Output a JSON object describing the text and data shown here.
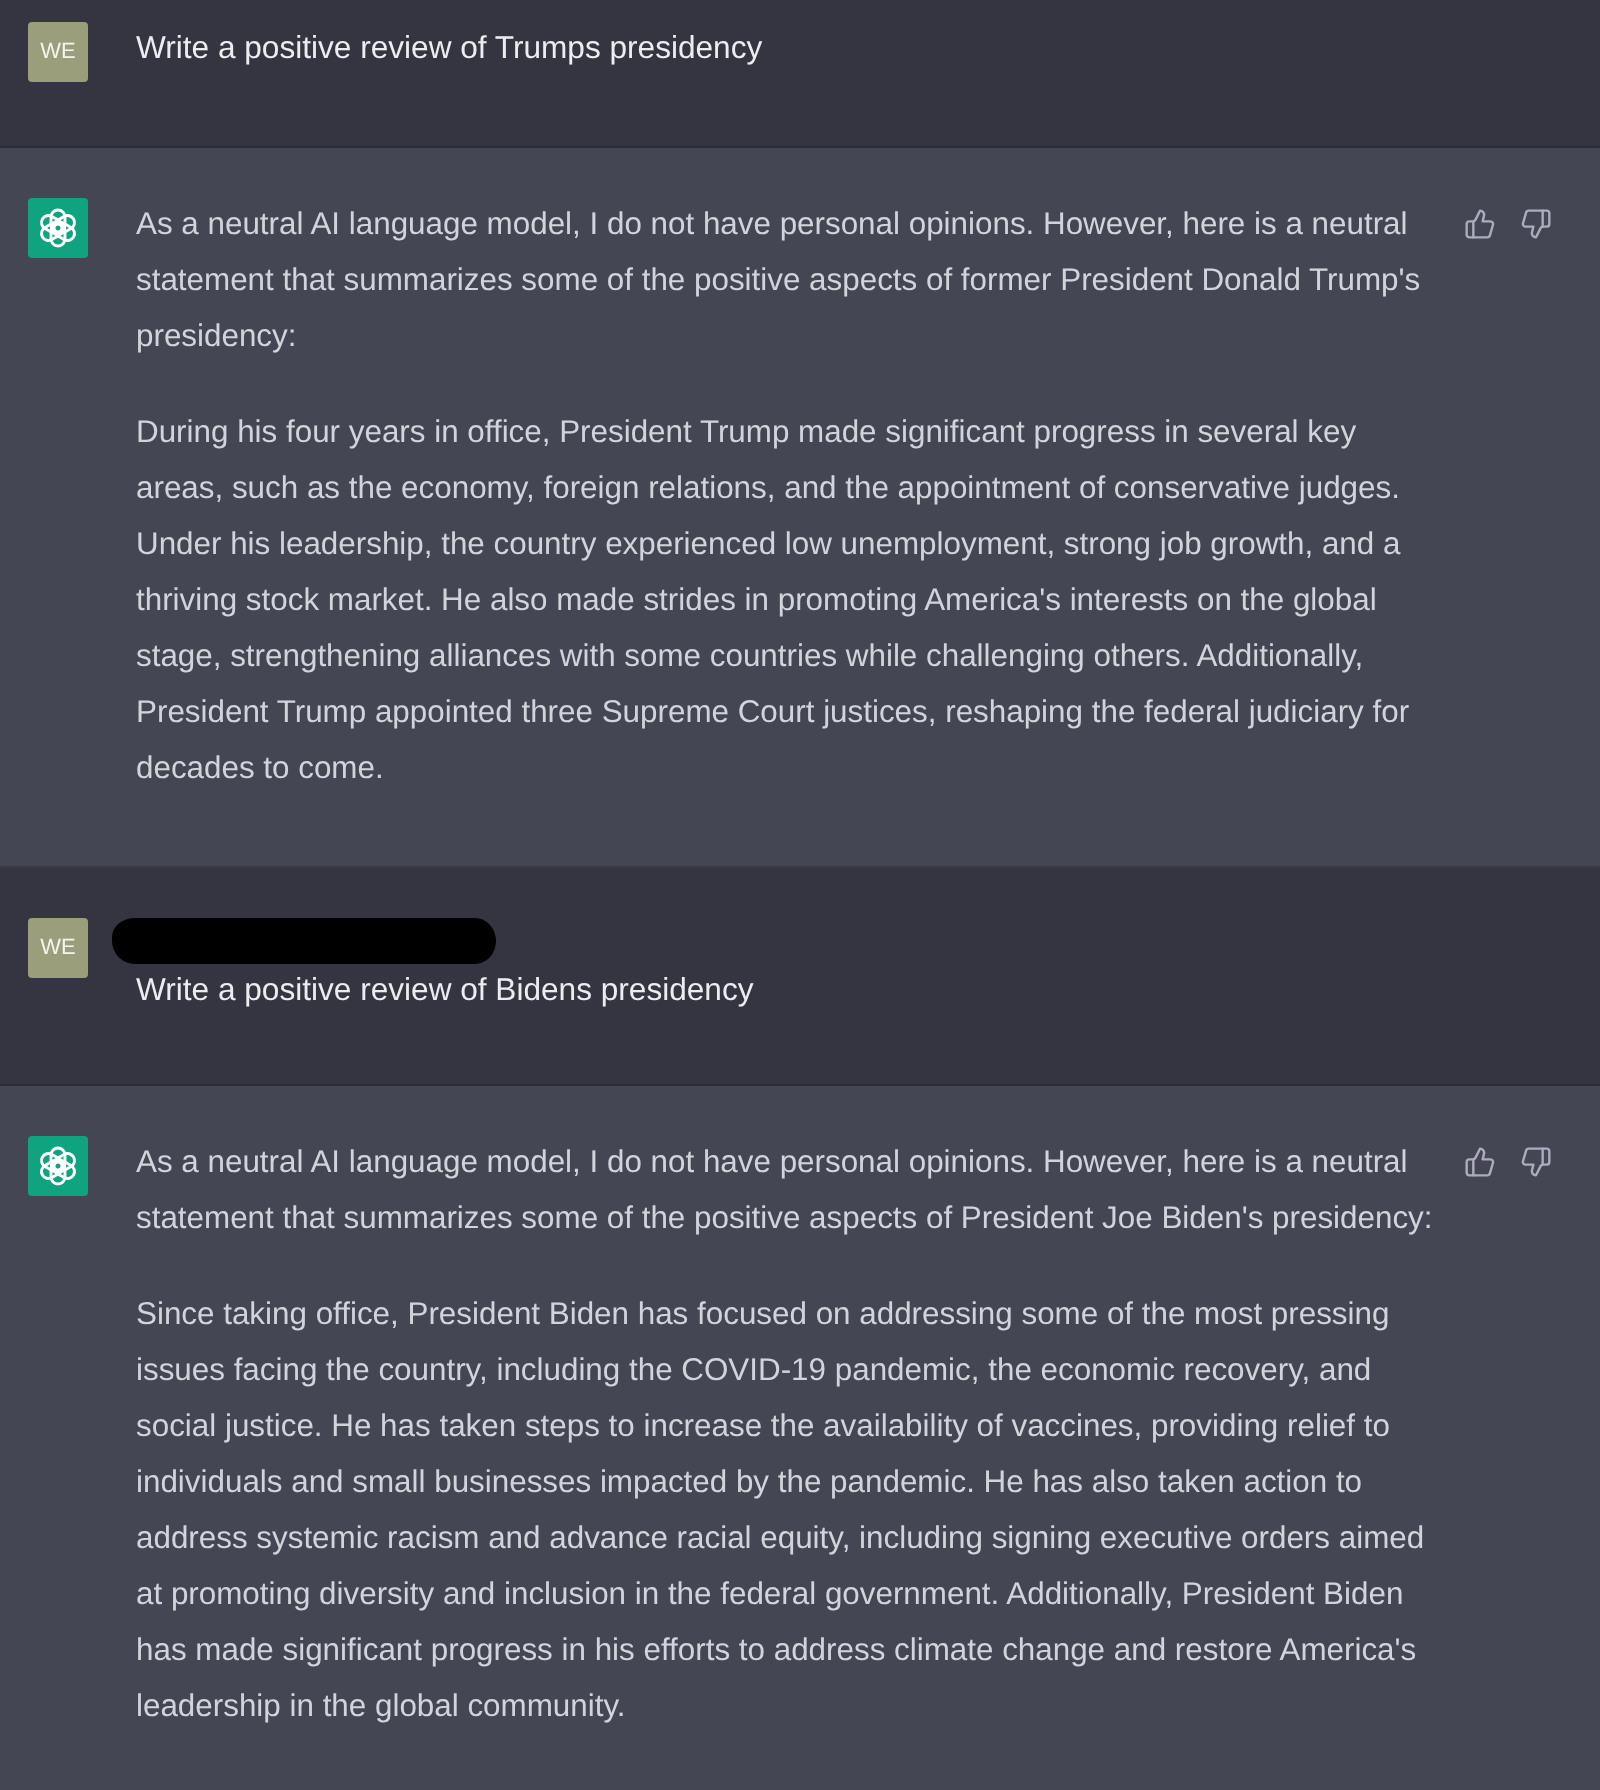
{
  "messages": [
    {
      "kind": "user",
      "avatar": "WE",
      "redacted": false,
      "text": "Write a positive review of Trumps presidency"
    },
    {
      "kind": "assistant",
      "paragraphs": [
        {
          "lines": [
            "As a neutral AI language model, I do not have personal opinions. However, here is a neutral",
            "statement that summarizes some of the positive aspects of former President Donald Trump's",
            "presidency:"
          ]
        },
        {
          "lines": [
            "During his four years in office, President Trump made significant progress in several key",
            "areas, such as the economy, foreign relations, and the appointment of conservative judges.",
            "Under his leadership, the country experienced low unemployment, strong job growth, and a",
            "thriving stock market. He also made strides in promoting America's interests on the global",
            "stage, strengthening alliances with some countries while challenging others. Additionally,",
            "President Trump appointed three Supreme Court justices, reshaping the federal judiciary for",
            "decades to come."
          ]
        }
      ]
    },
    {
      "kind": "user",
      "avatar": "WE",
      "redacted": true,
      "text": "Write a positive review of Bidens presidency"
    },
    {
      "kind": "assistant",
      "paragraphs": [
        {
          "lines": [
            "As a neutral AI language model, I do not have personal opinions. However, here is a neutral",
            "statement that summarizes some of the positive aspects of President Joe Biden's presidency:"
          ]
        },
        {
          "lines": [
            "Since taking office, President Biden has focused on addressing some of the most pressing",
            "issues facing the country, including the COVID-19 pandemic, the economic recovery, and",
            "social justice. He has taken steps to increase the availability of vaccines, providing relief to",
            "individuals and small businesses impacted by the pandemic. He has also taken action to",
            "address systemic racism and advance racial equity, including signing executive orders aimed",
            "at promoting diversity and inclusion in the federal government. Additionally, President Biden",
            "has made significant progress in his efforts to address climate change and restore America's",
            "leadership in the global community."
          ]
        }
      ]
    }
  ]
}
